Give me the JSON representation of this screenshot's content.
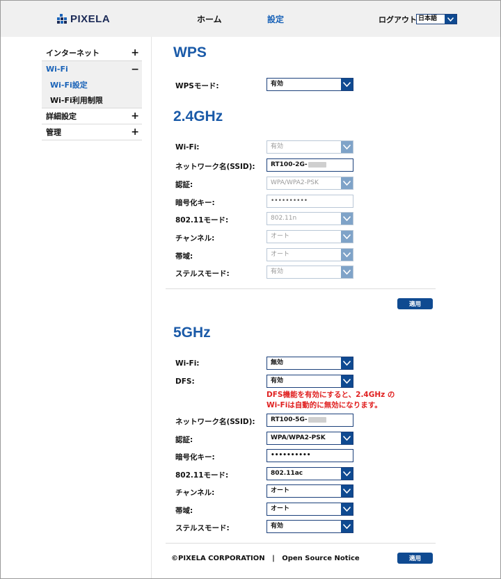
{
  "header": {
    "logo_text": "PIXELA",
    "nav_home": "ホーム",
    "nav_settings": "設定",
    "logout": "ログアウト",
    "language": "日本語"
  },
  "sidebar": {
    "items": [
      {
        "label": "インターネット",
        "toggle": "+"
      },
      {
        "label": "Wi-Fi",
        "toggle": "−"
      },
      {
        "label": "詳細設定",
        "toggle": "+"
      },
      {
        "label": "管理",
        "toggle": "+"
      }
    ],
    "wifi_sub": [
      "Wi-Fi設定",
      "Wi-Fi利用制限"
    ]
  },
  "wps": {
    "title": "WPS",
    "mode_label": "WPSモード:",
    "mode_value": "有効"
  },
  "band24": {
    "title": "2.4GHz",
    "wifi_label": "Wi-Fi:",
    "wifi_value": "有効",
    "ssid_label": "ネットワーク名(SSID):",
    "ssid_value": "RT100-2G-",
    "auth_label": "認証:",
    "auth_value": "WPA/WPA2-PSK",
    "key_label": "暗号化キー:",
    "key_value": "••••••••••",
    "mode_label": "802.11モード:",
    "mode_value": "802.11n",
    "channel_label": "チャンネル:",
    "channel_value": "オート",
    "bandwidth_label": "帯域:",
    "bandwidth_value": "オート",
    "stealth_label": "ステルスモード:",
    "stealth_value": "有効",
    "apply": "適用"
  },
  "band5": {
    "title": "5GHz",
    "wifi_label": "Wi-Fi:",
    "wifi_value": "無効",
    "dfs_label": "DFS:",
    "dfs_value": "有効",
    "warning_line1": "DFS機能を有効にすると、2.4GHz の",
    "warning_line2": "Wi-Fiは自動的に無効になります。",
    "ssid_label": "ネットワーク名(SSID):",
    "ssid_value": "RT100-5G-",
    "auth_label": "認証:",
    "auth_value": "WPA/WPA2-PSK",
    "key_label": "暗号化キー:",
    "key_value": "••••••••••",
    "mode_label": "802.11モード:",
    "mode_value": "802.11ac",
    "channel_label": "チャンネル:",
    "channel_value": "オート",
    "bandwidth_label": "帯域:",
    "bandwidth_value": "オート",
    "stealth_label": "ステルスモード:",
    "stealth_value": "有効",
    "apply": "適用"
  },
  "footer": {
    "copyright": "©PIXELA CORPORATION",
    "separator": "|",
    "oss": "Open Source Notice"
  },
  "colors": {
    "accent": "#1a5aa8",
    "button": "#0f4a91",
    "warning": "#e02020"
  }
}
